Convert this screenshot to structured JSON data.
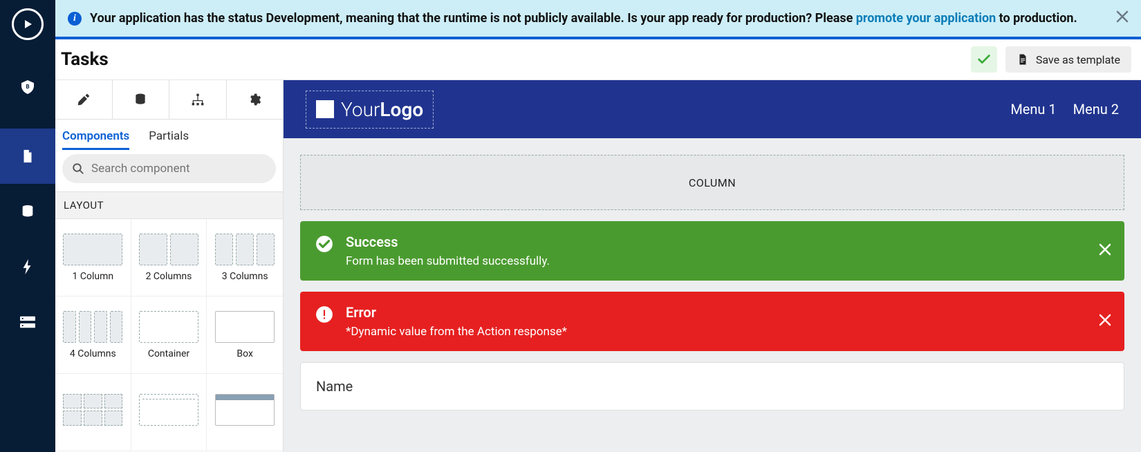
{
  "banner": {
    "text_before_link": "Your application has the status Development, meaning that the runtime is not publicly available. Is your app ready for production? Please ",
    "link_text": "promote your application",
    "text_after_link": " to production."
  },
  "topbar": {
    "title": "Tasks",
    "save_label": "Save as template"
  },
  "palette": {
    "sub_tabs": {
      "components": "Components",
      "partials": "Partials"
    },
    "search_placeholder": "Search component",
    "sections": {
      "layout": "LAYOUT"
    },
    "items": {
      "col1": "1 Column",
      "col2": "2 Columns",
      "col3": "3 Columns",
      "col4": "4 Columns",
      "container": "Container",
      "box": "Box"
    }
  },
  "canvas": {
    "logo_text_light": "Your",
    "logo_text_bold": "Logo",
    "menus": [
      "Menu 1",
      "Menu 2"
    ],
    "column_placeholder": "COLUMN",
    "success": {
      "title": "Success",
      "body": "Form has been submitted successfully."
    },
    "error": {
      "title": "Error",
      "body": "*Dynamic value from the Action response*"
    },
    "field_label": "Name"
  }
}
